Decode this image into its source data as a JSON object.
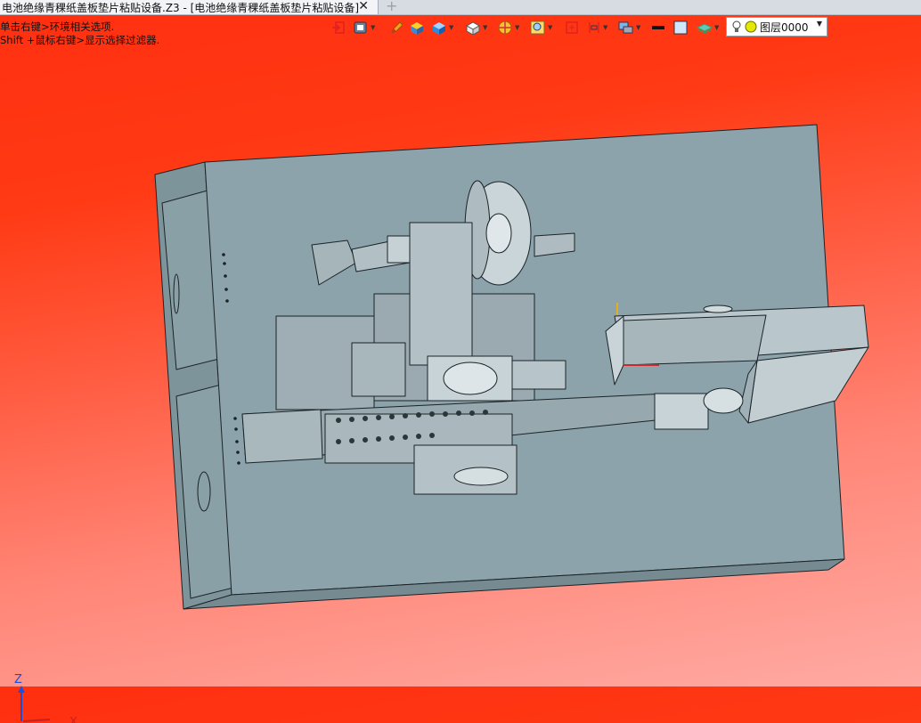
{
  "window": {
    "tab_title": "电池绝缘青稞纸盖板垫片粘贴设备.Z3 - [电池绝缘青稞纸盖板垫片粘贴设备]",
    "close_glyph": "✕",
    "add_tab_glyph": "+"
  },
  "hints": {
    "line1": "单击右键>环境相关选项.",
    "line2": "Shift +鼠标右键>显示选择过滤器."
  },
  "toolbar": {
    "items": [
      {
        "name": "exit-icon"
      },
      {
        "name": "view-style-icon"
      },
      {
        "name": "pencil-icon"
      },
      {
        "name": "shaded-box-icon"
      },
      {
        "name": "blue-cube-icon"
      },
      {
        "name": "white-cube-icon"
      },
      {
        "name": "section-icon"
      },
      {
        "name": "zoom-icon"
      },
      {
        "name": "fit-icon"
      },
      {
        "name": "align-icon"
      },
      {
        "name": "display-icon"
      },
      {
        "name": "color-black-icon"
      },
      {
        "name": "color-light-icon"
      },
      {
        "name": "layer-stack-icon"
      }
    ],
    "layer_selector": {
      "value": "图层0000",
      "bulb_icon": "lightbulb-icon",
      "status_color": "#e5e800"
    }
  },
  "viewport": {
    "background_top": "#ff2f10",
    "background_bottom": "#ffaaa3",
    "model_color": "#8ca3ab",
    "axis_labels": {
      "z": "Z",
      "x": "X"
    }
  }
}
